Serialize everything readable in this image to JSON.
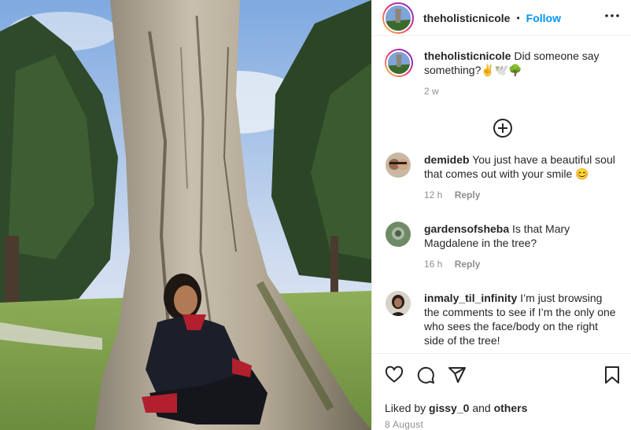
{
  "post": {
    "photo_alt": "photo",
    "header": {
      "username": "theholisticnicole",
      "separator": "•",
      "follow_label": "Follow",
      "more_icon": "more-icon"
    },
    "caption": {
      "username": "theholisticnicole",
      "text": "Did someone say something?✌️🕊️🌳",
      "age": "2 w"
    },
    "load_more_icon": "plus-circle-icon",
    "comments": [
      {
        "username": "demideb",
        "text": "You just have a beautiful soul that comes out with your smile 😊",
        "age": "12 h",
        "reply": "Reply"
      },
      {
        "username": "gardensofsheba",
        "text": "Is that Mary Magdalene in the tree?",
        "age": "16 h",
        "reply": "Reply"
      },
      {
        "username": "inmaly_til_infinity",
        "text": "I’m just browsing the comments to see if I’m the only one who sees the face/body on the right side of the tree!",
        "age": "",
        "reply": ""
      }
    ],
    "actions": {
      "like_icon": "heart-icon",
      "comment_icon": "comment-icon",
      "share_icon": "share-icon",
      "save_icon": "bookmark-icon"
    },
    "likes": {
      "prefix": "Liked by",
      "user": "gissy_0",
      "and": "and",
      "others": "others"
    },
    "date": "8 August"
  },
  "colors": {
    "accent": "#0095f6",
    "text": "#262626",
    "muted": "#8e8e8e"
  }
}
